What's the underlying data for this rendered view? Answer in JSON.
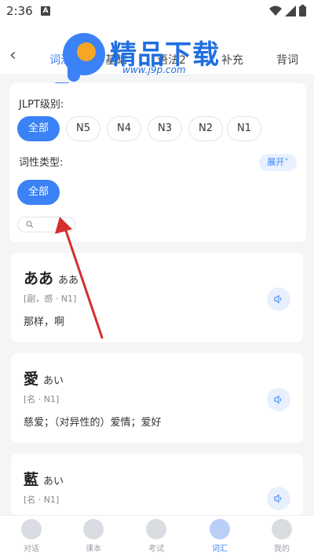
{
  "status_bar": {
    "time": "2:36",
    "notif_letter": "A"
  },
  "header": {
    "back_label": "‹",
    "tabs": [
      {
        "label": "词汇",
        "active": true
      },
      {
        "label": "基础",
        "active": false
      },
      {
        "label": "语法2",
        "active": false
      },
      {
        "label": "补充",
        "active": false
      },
      {
        "label": "背词",
        "active": false
      }
    ]
  },
  "watermark": {
    "title": "精品下载",
    "url": "www.j9p.com"
  },
  "filter": {
    "jlpt_label": "JLPT级别:",
    "levels": [
      {
        "label": "全部",
        "active": true
      },
      {
        "label": "N5",
        "active": false
      },
      {
        "label": "N4",
        "active": false
      },
      {
        "label": "N3",
        "active": false
      },
      {
        "label": "N2",
        "active": false
      },
      {
        "label": "N1",
        "active": false
      }
    ],
    "pos_label": "词性类型:",
    "expand_label": "展开",
    "pos_options": [
      {
        "label": "全部",
        "active": true
      }
    ]
  },
  "words": [
    {
      "kanji": "ああ",
      "kana": "ああ",
      "tag": "[副，感 · N1]",
      "meaning": "那样，啊"
    },
    {
      "kanji": "愛",
      "kana": "あい",
      "tag": "[名 · N1]",
      "meaning": "慈爱；（对异性的）爱情；爱好"
    },
    {
      "kanji": "藍",
      "kana": "あい",
      "tag": "[名 · N1]",
      "meaning": ""
    }
  ],
  "bottom_nav": [
    {
      "label": "对话",
      "icon": "heart-bubble-icon",
      "active": false
    },
    {
      "label": "课本",
      "icon": "book-icon",
      "active": false
    },
    {
      "label": "考试",
      "icon": "exam-icon",
      "active": false
    },
    {
      "label": "词汇",
      "icon": "star-icon",
      "active": true
    },
    {
      "label": "我的",
      "icon": "profile-icon",
      "active": false
    }
  ],
  "colors": {
    "accent": "#3b82f6",
    "annotation_arrow": "#d32f2f"
  }
}
